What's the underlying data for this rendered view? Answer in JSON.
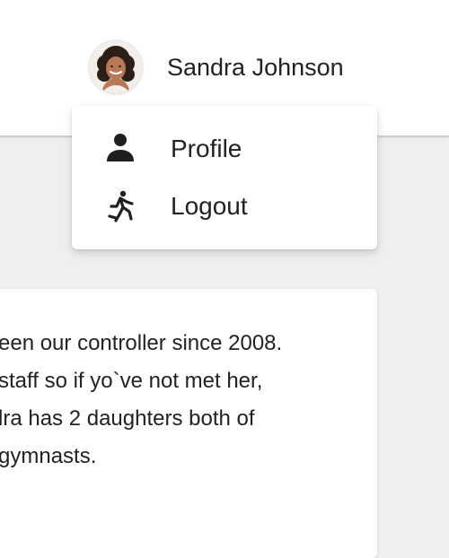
{
  "header": {
    "user_name": "Sandra Johnson",
    "avatar_icon": "user-avatar-photo"
  },
  "menu": {
    "items": [
      {
        "label": "Profile",
        "icon": "person-icon"
      },
      {
        "label": "Logout",
        "icon": "running-person-icon"
      }
    ]
  },
  "bio": {
    "lines": [
      "een our controller since 2008.",
      "staff so if yo`ve not met her,",
      "lra has 2 daughters both of",
      "gymnasts."
    ]
  },
  "colors": {
    "page_background": "#efefef",
    "surface": "#ffffff",
    "text": "#222222"
  }
}
